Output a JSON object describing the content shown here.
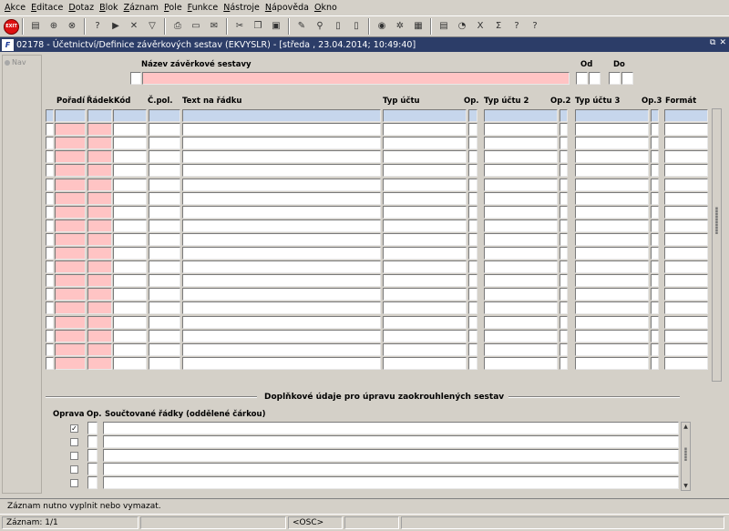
{
  "menu": [
    "Akce",
    "Editace",
    "Dotaz",
    "Blok",
    "Záznam",
    "Pole",
    "Funkce",
    "Nástroje",
    "Nápověda",
    "Okno"
  ],
  "toolbar_icons": [
    "exit-icon",
    "save-icon",
    "insert-record-icon",
    "delete-record-icon",
    "query-icon",
    "execute-query-icon",
    "clear-icon",
    "filter-icon",
    "print-icon",
    "open-icon",
    "mail-icon",
    "cut-icon",
    "copy-icon",
    "paste-icon",
    "edit-icon",
    "zoom-icon",
    "document-icon",
    "new-document-icon",
    "globe-icon",
    "settings-icon",
    "calculator-icon",
    "report-icon",
    "chart-icon",
    "excel-icon",
    "sum-icon",
    "help-icon",
    "context-help-icon"
  ],
  "window": {
    "logo": "F",
    "title": "02178 - Účetnictví/Definice závěrkových sestav (EKVYSLR) - [středa , 23.04.2014; 10:49:40]",
    "restore": "⧉",
    "close": "✕"
  },
  "nav": {
    "label": "Nav"
  },
  "header_form": {
    "name_label": "Název závěrkové sestavy",
    "name_value": "",
    "from_label": "Od",
    "to_label": "Do"
  },
  "grid": {
    "columns": {
      "poradi": "Pořadí",
      "radek": "Řádek",
      "kod": "Kód",
      "cpol": "Č.pol.",
      "text": "Text na řádku",
      "typ1": "Typ účtu",
      "op1": "Op.",
      "typ2": "Typ účtu 2",
      "op2": "Op.2",
      "typ3": "Typ účtu 3",
      "op3": "Op.3",
      "format": "Formát"
    },
    "row_count": 19,
    "selected_row": 0
  },
  "detail": {
    "title": "Doplňkové údaje pro úpravu zaokrouhlených sestav",
    "col_oprava": "Oprava",
    "col_op": "Op.",
    "col_rows": "Součtované řádky (oddělené čárkou)",
    "rows": [
      {
        "checked": true,
        "op": "",
        "value": ""
      },
      {
        "checked": false,
        "op": "",
        "value": ""
      },
      {
        "checked": false,
        "op": "",
        "value": ""
      },
      {
        "checked": false,
        "op": "",
        "value": ""
      },
      {
        "checked": false,
        "op": "",
        "value": ""
      }
    ]
  },
  "status": {
    "message": "Záznam nutno vyplnit nebo vymazat.",
    "record": "Záznam: 1/1",
    "osc": "<OSC>"
  }
}
